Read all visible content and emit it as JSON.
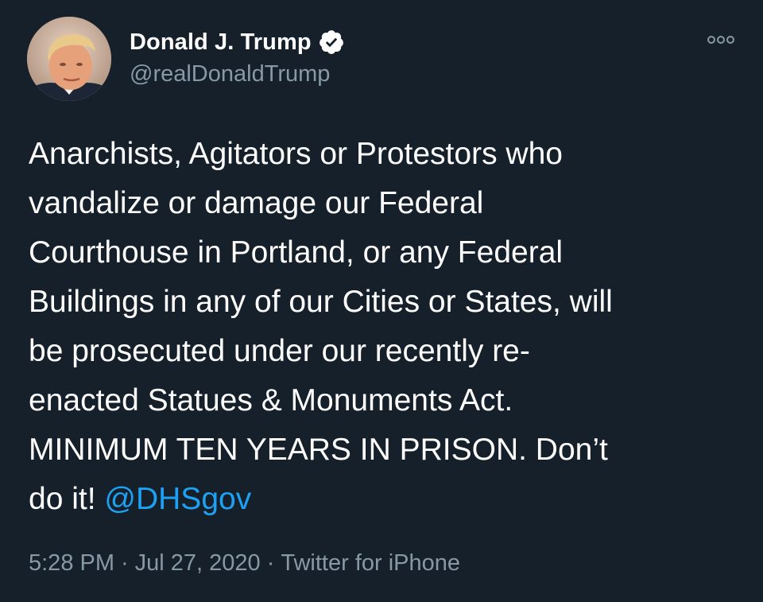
{
  "author": {
    "display_name": "Donald J. Trump",
    "handle": "@realDonaldTrump",
    "verified": true,
    "avatar_icon": "profile-photo"
  },
  "tweet": {
    "text": "Anarchists, Agitators or Protestors who\nvandalize or damage our Federal\nCourthouse in Portland, or any Federal\nBuildings in any of our Cities or States, will\nbe prosecuted under our recently re-\nenacted Statues & Monuments Act.\nMINIMUM TEN YEARS IN PRISON. Don’t\ndo it! ",
    "mention": "@DHSgov"
  },
  "meta": {
    "time": "5:28 PM",
    "separator": "·",
    "date": "Jul 27, 2020",
    "source": "Twitter for iPhone"
  },
  "icons": {
    "verified": "verified-badge-icon",
    "more": "more-options-icon"
  },
  "colors": {
    "background": "#15202b",
    "secondary_text": "#8899a6",
    "link": "#1da1f2"
  }
}
